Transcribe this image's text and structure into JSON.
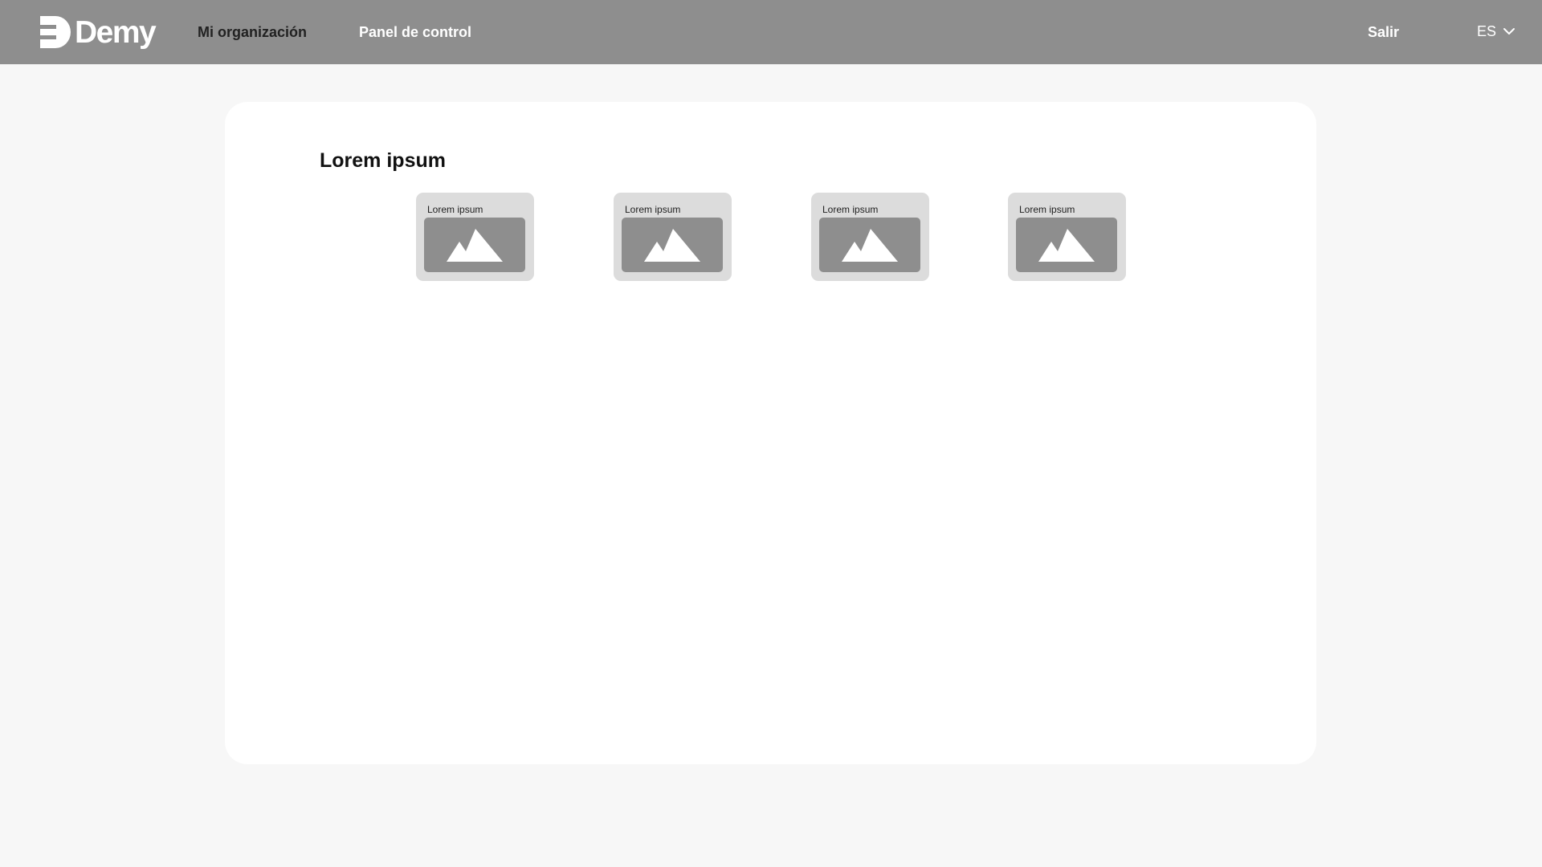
{
  "brand": {
    "name": "Demy"
  },
  "nav": {
    "items": [
      {
        "label": "Mi organización",
        "active": true
      },
      {
        "label": "Panel de control",
        "active": false
      }
    ],
    "logout_label": "Salir",
    "language": "ES"
  },
  "section": {
    "title": "Lorem ipsum",
    "tiles": [
      {
        "label": "Lorem ipsum",
        "icon": "image-placeholder-icon"
      },
      {
        "label": "Lorem ipsum",
        "icon": "image-placeholder-icon"
      },
      {
        "label": "Lorem ipsum",
        "icon": "image-placeholder-icon"
      },
      {
        "label": "Lorem ipsum",
        "icon": "image-placeholder-icon"
      }
    ]
  },
  "colors": {
    "topbar": "#8e8e8e",
    "background": "#f7f7f7",
    "card": "#ffffff",
    "tile": "#dcdcdc",
    "tile_image": "#8e8e8e",
    "nav_active_text": "#222222",
    "nav_text": "#ffffff"
  }
}
